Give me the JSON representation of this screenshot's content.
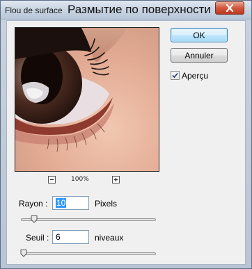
{
  "window": {
    "title": "Flou de surface",
    "subtitle": "Размытие по поверхности",
    "close_icon": "close-x-icon"
  },
  "preview": {
    "zoom_level": "100%",
    "zoom_out_icon": "minus-icon",
    "zoom_in_icon": "plus-icon"
  },
  "rayon": {
    "label": "Rayon :",
    "value": "10",
    "unit": "Pixels",
    "slider_fraction": 0.1
  },
  "seuil": {
    "label": "Seuil :",
    "value": "6",
    "unit": "niveaux",
    "slider_fraction": 0.02
  },
  "buttons": {
    "ok": "OK",
    "cancel": "Annuler"
  },
  "preview_checkbox": {
    "label": "Aperçu",
    "checked": true
  },
  "colors": {
    "close_button": "#c9452c",
    "default_button_border": "#3c7fb1",
    "selection": "#3399ff"
  }
}
